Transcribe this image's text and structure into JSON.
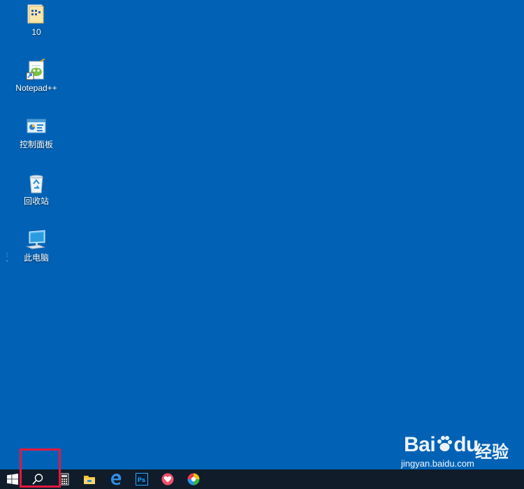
{
  "desktop": {
    "icons": [
      {
        "label": "10",
        "icon": "folder-icon"
      },
      {
        "label": "Notepad++",
        "icon": "notepad-plus-plus-icon"
      },
      {
        "label": "控制面板",
        "icon": "control-panel-icon"
      },
      {
        "label": "回收站",
        "icon": "recycle-bin-icon"
      },
      {
        "label": "此电脑",
        "icon": "this-pc-icon"
      }
    ],
    "background_color": "#0162b5"
  },
  "watermark": {
    "logo_text": "Bai",
    "logo_suffix": "du",
    "brand_cn": "经验",
    "url": "jingyan.baidu.com"
  },
  "taskbar": {
    "background_color": "#101c2a",
    "items": [
      {
        "name": "start",
        "icon": "windows-start-icon"
      },
      {
        "name": "search",
        "icon": "search-icon"
      },
      {
        "name": "calculator",
        "icon": "calculator-icon"
      },
      {
        "name": "file-explorer",
        "icon": "folder-explorer-icon"
      },
      {
        "name": "edge",
        "icon": "edge-browser-icon"
      },
      {
        "name": "photoshop",
        "icon": "photoshop-icon",
        "text": "Ps"
      },
      {
        "name": "heart-app",
        "icon": "heart-app-icon"
      },
      {
        "name": "colorful-app",
        "icon": "color-wheel-icon"
      }
    ]
  },
  "annotation": {
    "color": "#e3183f",
    "target": "search"
  }
}
